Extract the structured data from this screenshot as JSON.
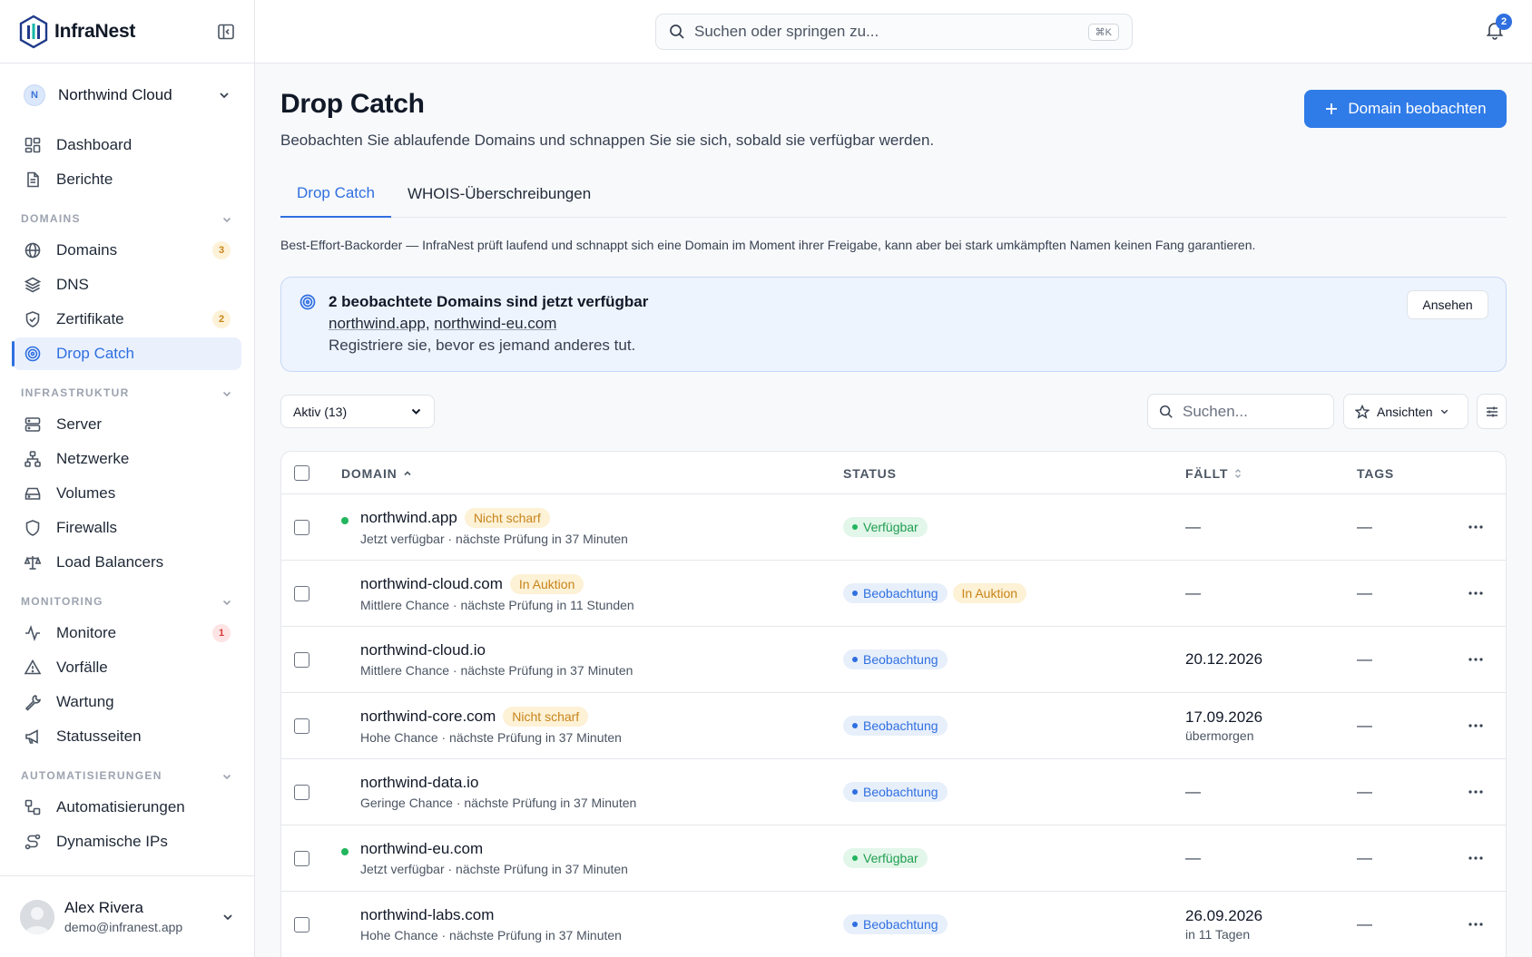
{
  "brand": {
    "name": "InfraNest"
  },
  "org": {
    "initial": "N",
    "name": "Northwind Cloud"
  },
  "sidebar": {
    "top_items": [
      {
        "label": "Dashboard",
        "icon": "dashboard-icon"
      },
      {
        "label": "Berichte",
        "icon": "document-icon"
      }
    ],
    "sections": [
      {
        "label": "DOMAINS",
        "items": [
          {
            "label": "Domains",
            "icon": "globe-icon",
            "badge": "3"
          },
          {
            "label": "DNS",
            "icon": "layers-icon"
          },
          {
            "label": "Zertifikate",
            "icon": "shield-check-icon",
            "badge": "2"
          },
          {
            "label": "Drop Catch",
            "icon": "target-icon"
          }
        ]
      },
      {
        "label": "INFRASTRUKTUR",
        "items": [
          {
            "label": "Server",
            "icon": "server-icon"
          },
          {
            "label": "Netzwerke",
            "icon": "network-icon"
          },
          {
            "label": "Volumes",
            "icon": "drive-icon"
          },
          {
            "label": "Firewalls",
            "icon": "shield-icon"
          },
          {
            "label": "Load Balancers",
            "icon": "scale-icon"
          }
        ]
      },
      {
        "label": "MONITORING",
        "items": [
          {
            "label": "Monitore",
            "icon": "activity-icon",
            "badge": "1"
          },
          {
            "label": "Vorfälle",
            "icon": "warning-icon"
          },
          {
            "label": "Wartung",
            "icon": "wrench-icon"
          },
          {
            "label": "Statusseiten",
            "icon": "megaphone-icon"
          }
        ]
      },
      {
        "label": "AUTOMATISIERUNGEN",
        "items": [
          {
            "label": "Automatisierungen",
            "icon": "workflow-icon"
          },
          {
            "label": "Dynamische IPs",
            "icon": "route-icon"
          }
        ]
      }
    ]
  },
  "user": {
    "name": "Alex Rivera",
    "email": "demo@infranest.app"
  },
  "topbar": {
    "search_placeholder": "Suchen oder springen zu...",
    "shortcut": "⌘K",
    "notifications": "2"
  },
  "page": {
    "title": "Drop Catch",
    "subtitle": "Beobachten Sie ablaufende Domains und schnappen Sie sie sich, sobald sie verfügbar werden.",
    "primary_button": "Domain beobachten",
    "tabs": [
      "Drop Catch",
      "WHOIS-Überschreibungen"
    ],
    "note": "Best-Effort-Backorder — InfraNest prüft laufend und schnappt sich eine Domain im Moment ihrer Freigabe, kann aber bei stark umkämpften Namen keinen Fang garantieren."
  },
  "alert": {
    "title": "2 beobachtete Domains sind jetzt verfügbar",
    "link1": "northwind.app",
    "separator": ", ",
    "link2": "northwind-eu.com",
    "description": "Registriere sie, bevor es jemand anderes tut.",
    "button": "Ansehen"
  },
  "toolbar": {
    "filter_value": "Aktiv (13)",
    "search_placeholder": "Suchen...",
    "views_label": "Ansichten"
  },
  "table": {
    "columns": {
      "domain": "DOMAIN",
      "status": "STATUS",
      "due": "FÄLLT",
      "tags": "TAGS"
    },
    "rows": [
      {
        "domain": "northwind.app",
        "dot": true,
        "tag": "Nicht scharf",
        "meta": "Jetzt verfügbar · nächste Prüfung in 37 Minuten",
        "status": "Verfügbar",
        "status_kind": "green",
        "status_extra": "",
        "due": "—",
        "due_sub": "",
        "tags": "—"
      },
      {
        "domain": "northwind-cloud.com",
        "dot": false,
        "tag": "In Auktion",
        "meta": "Mittlere Chance · nächste Prüfung in 11 Stunden",
        "status": "Beobachtung",
        "status_kind": "blue",
        "status_extra": "In Auktion",
        "due": "—",
        "due_sub": "",
        "tags": "—"
      },
      {
        "domain": "northwind-cloud.io",
        "dot": false,
        "tag": "",
        "meta": "Mittlere Chance · nächste Prüfung in 37 Minuten",
        "status": "Beobachtung",
        "status_kind": "blue",
        "status_extra": "",
        "due": "20.12.2026",
        "due_sub": "",
        "tags": "—"
      },
      {
        "domain": "northwind-core.com",
        "dot": false,
        "tag": "Nicht scharf",
        "meta": "Hohe Chance · nächste Prüfung in 37 Minuten",
        "status": "Beobachtung",
        "status_kind": "blue",
        "status_extra": "",
        "due": "17.09.2026",
        "due_sub": "übermorgen",
        "tags": "—"
      },
      {
        "domain": "northwind-data.io",
        "dot": false,
        "tag": "",
        "meta": "Geringe Chance · nächste Prüfung in 37 Minuten",
        "status": "Beobachtung",
        "status_kind": "blue",
        "status_extra": "",
        "due": "—",
        "due_sub": "",
        "tags": "—"
      },
      {
        "domain": "northwind-eu.com",
        "dot": true,
        "tag": "",
        "meta": "Jetzt verfügbar · nächste Prüfung in 37 Minuten",
        "status": "Verfügbar",
        "status_kind": "green",
        "status_extra": "",
        "due": "—",
        "due_sub": "",
        "tags": "—"
      },
      {
        "domain": "northwind-labs.com",
        "dot": false,
        "tag": "",
        "meta": "Hohe Chance · nächste Prüfung in 37 Minuten",
        "status": "Beobachtung",
        "status_kind": "blue",
        "status_extra": "",
        "due": "26.09.2026",
        "due_sub": "in 11 Tagen",
        "tags": "—"
      }
    ]
  },
  "colors": {
    "accent": "#2f7be8",
    "available": "#22b55e",
    "warning": "#c7851a"
  }
}
